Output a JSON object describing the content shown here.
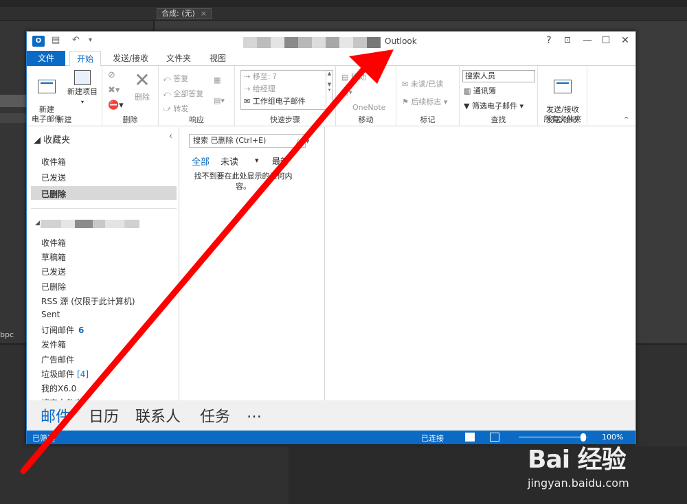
{
  "window": {
    "title": "Outlook"
  },
  "ribbon_tabs": [
    "文件",
    "开始",
    "发送/接收",
    "文件夹",
    "视图"
  ],
  "groups": {
    "new": {
      "label": "新建",
      "new_mail": "新建\n电子邮件",
      "new_item": "新建项目"
    },
    "delete": {
      "label": "删除",
      "delete_btn": "删除"
    },
    "respond": {
      "label": "响应",
      "reply": "答复",
      "reply_all": "全部答复",
      "forward": "转发"
    },
    "quick_steps": {
      "label": "快速步骤",
      "items": [
        "移至: ?",
        "给经理",
        "工作组电子邮件"
      ]
    },
    "move": {
      "label": "移动",
      "move": "移动",
      "onenote": "OneNote"
    },
    "tags": {
      "label": "标记",
      "unread_read": "未读/已读",
      "follow_up": "后续标志"
    },
    "find": {
      "label": "查找",
      "search_people": "搜索人员",
      "address_book": "通讯簿",
      "filter_email": "筛选电子邮件"
    },
    "send_receive": {
      "label": "发送/接收",
      "send_all": "发送/接收\n所有文件夹"
    }
  },
  "favorites": {
    "header": "收藏夹",
    "items": [
      "收件箱",
      "已发送",
      "已删除"
    ],
    "selected": "已删除"
  },
  "account_folders": [
    {
      "label": "收件箱"
    },
    {
      "label": "草稿箱"
    },
    {
      "label": "已发送"
    },
    {
      "label": "已删除"
    },
    {
      "label": "RSS 源 (仅限于此计算机)"
    },
    {
      "label": "Sent"
    },
    {
      "label": "订阅邮件",
      "count": "6"
    },
    {
      "label": "发件箱"
    },
    {
      "label": "广告邮件"
    },
    {
      "label": "垃圾邮件",
      "count": "[4]"
    },
    {
      "label": "我的X6.0"
    },
    {
      "label": "搜索文件夹"
    }
  ],
  "message_list": {
    "search_placeholder": "搜索 已删除 (Ctrl+E)",
    "filters": [
      "全部",
      "未读"
    ],
    "sort": "最新",
    "empty_message": "找不到要在此处显示的任何内容。"
  },
  "nav": [
    "邮件",
    "日历",
    "联系人",
    "任务",
    "…"
  ],
  "status": {
    "left": "已筛选",
    "connection": "已连接",
    "zoom": "100%"
  },
  "background": {
    "tab_label": "合成: (无)",
    "bpc": "bpc"
  },
  "watermark": {
    "logo": "Bai 经验",
    "url": "jingyan.baidu.com"
  },
  "colors": {
    "accent": "#0b6ac4",
    "arrow": "#ff0000"
  }
}
